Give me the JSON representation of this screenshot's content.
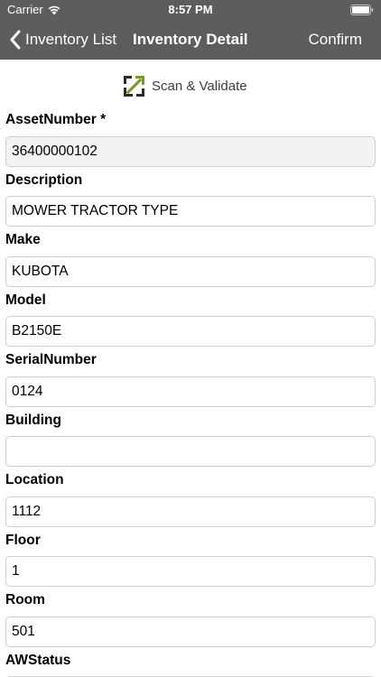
{
  "status_bar": {
    "carrier": "Carrier",
    "time": "8:57 PM"
  },
  "nav": {
    "back_label": "Inventory List",
    "title": "Inventory Detail",
    "confirm_label": "Confirm",
    "bar_color": "#5d5d5d"
  },
  "logo": {
    "text": "Scan & Validate",
    "colors": {
      "dark": "#2b2b2b",
      "green": "#7a9a2e"
    }
  },
  "fields": [
    {
      "label": "AssetNumber *",
      "value": "36400000102",
      "readonly": true
    },
    {
      "label": "Description",
      "value": "MOWER TRACTOR TYPE"
    },
    {
      "label": "Make",
      "value": "KUBOTA"
    },
    {
      "label": "Model",
      "value": "B2150E"
    },
    {
      "label": "SerialNumber",
      "value": "0124"
    },
    {
      "label": "Building",
      "value": ""
    },
    {
      "label": "Location",
      "value": "1112"
    },
    {
      "label": "Floor",
      "value": "1"
    },
    {
      "label": "Room",
      "value": "501"
    },
    {
      "label": "AWStatus",
      "value": ""
    }
  ]
}
